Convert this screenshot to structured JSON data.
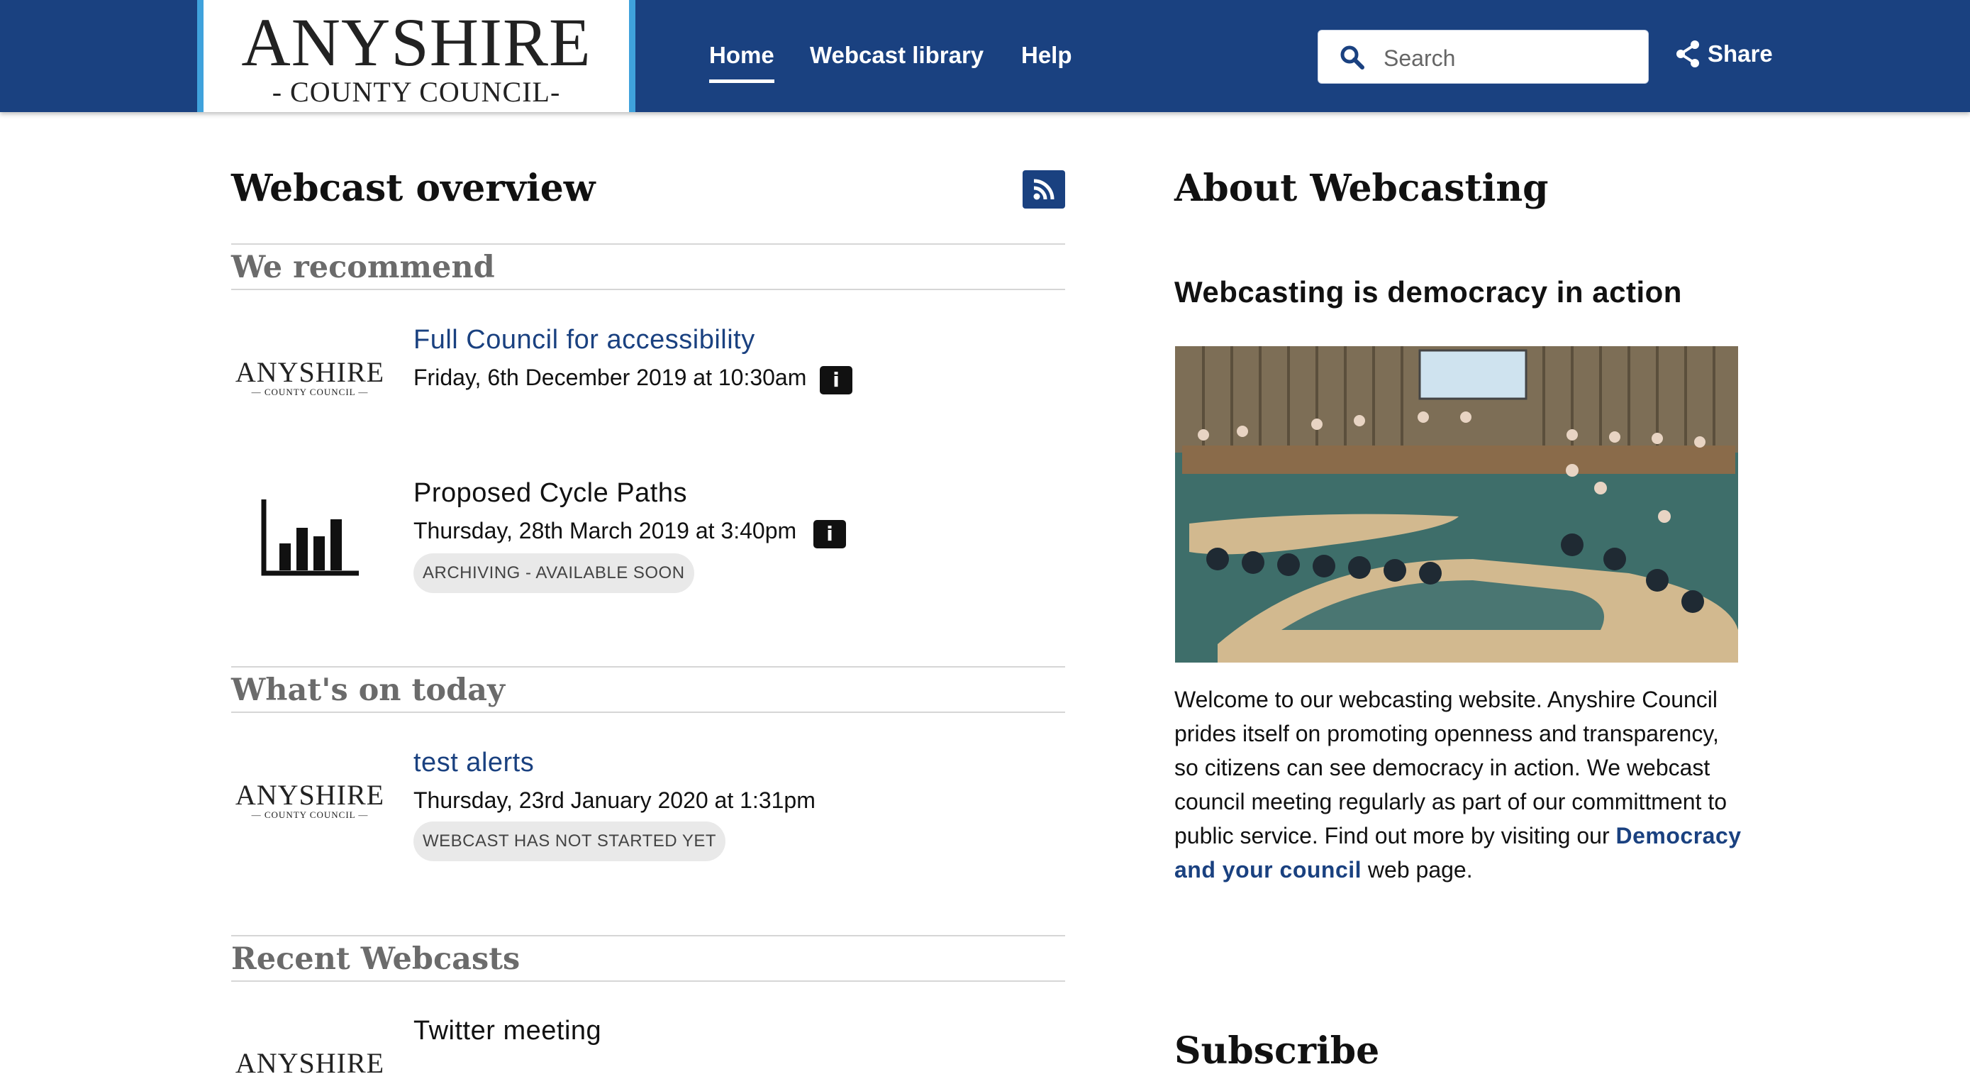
{
  "header": {
    "logo_main": "ANYSHIRE",
    "logo_sub": "- COUNTY COUNCIL-",
    "nav": [
      "Home",
      "Webcast library",
      "Help"
    ],
    "search_placeholder": "Search",
    "share_label": "Share"
  },
  "overview": {
    "title": "Webcast overview",
    "sections": {
      "recommend": "We recommend",
      "today": "What's on today",
      "recent": "Recent Webcasts"
    },
    "recommend_items": [
      {
        "title": "Full Council for accessibility",
        "date": "Friday, 6th December 2019 at 10:30am"
      },
      {
        "title": "Proposed Cycle Paths",
        "date": "Thursday, 28th March 2019 at 3:40pm",
        "badge": "ARCHIVING - AVAILABLE SOON"
      }
    ],
    "today_items": [
      {
        "title": "test alerts",
        "date": "Thursday, 23rd January 2020 at 1:31pm",
        "badge": "WEBCAST HAS NOT STARTED YET"
      }
    ],
    "recent_items": [
      {
        "title": "Twitter meeting"
      }
    ],
    "thumb_logo_main": "ANYSHIRE",
    "thumb_logo_sub": "— COUNTY COUNCIL —"
  },
  "about": {
    "title": "About Webcasting",
    "subtitle": "Webcasting is democracy in action",
    "text_before_link": "Welcome to our webcasting website. Anyshire Council prides itself on promoting openness and transparency, so citizens can see democracy in action. We webcast council meeting regularly as part of our committment to public service. Find out more by visiting our",
    "link_text": "Democracy and your council",
    "text_after_link": "web page.",
    "subscribe_title": "Subscribe"
  },
  "colors": {
    "brand_blue": "#1a4180",
    "logo_accent": "#3fa2dc",
    "section_gray": "#6b6b6b"
  }
}
